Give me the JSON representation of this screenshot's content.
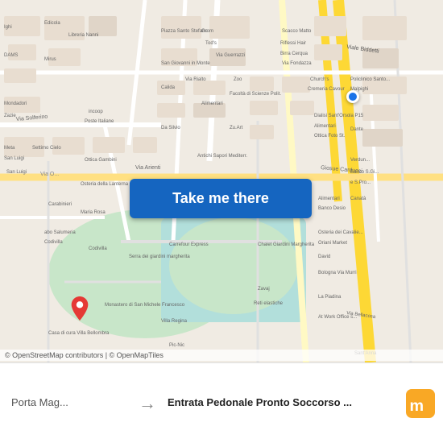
{
  "map": {
    "background_color": "#f0ebe3",
    "streets_color": "#ffffff",
    "park_color": "#c8e6c9",
    "highlight_color": "#a5d6a7"
  },
  "button": {
    "label": "Take me there",
    "bg_color": "#1565c0"
  },
  "attribution": {
    "text": "© OpenStreetMap contributors | © OpenMapTiles"
  },
  "bottom_bar": {
    "from_label": "Porta Mag...",
    "arrow": "→",
    "to_label": "Entrata Pedonale Pronto Soccorso ...",
    "logo_text": "moovit"
  }
}
